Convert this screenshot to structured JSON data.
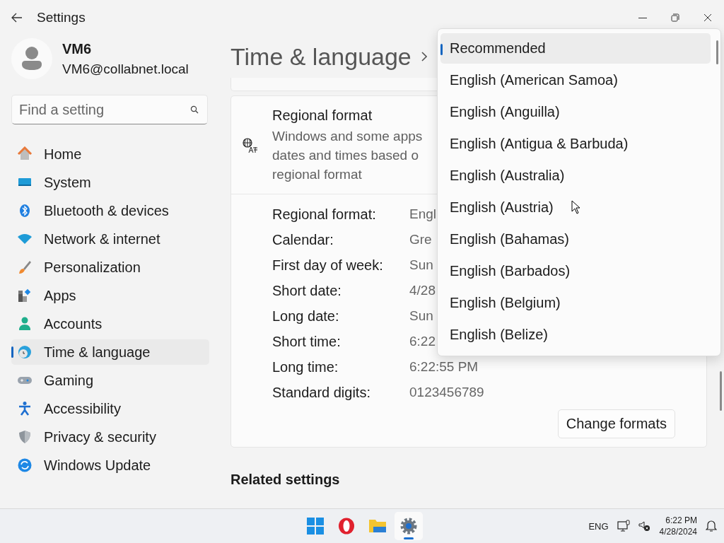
{
  "window": {
    "title": "Settings"
  },
  "user": {
    "name": "VM6",
    "email": "VM6@collabnet.local"
  },
  "search": {
    "placeholder": "Find a setting"
  },
  "nav": [
    {
      "label": "Home",
      "kind": "home",
      "selected": false
    },
    {
      "label": "System",
      "kind": "system",
      "selected": false
    },
    {
      "label": "Bluetooth & devices",
      "kind": "bluetooth",
      "selected": false
    },
    {
      "label": "Network & internet",
      "kind": "network",
      "selected": false
    },
    {
      "label": "Personalization",
      "kind": "brush",
      "selected": false
    },
    {
      "label": "Apps",
      "kind": "apps",
      "selected": false
    },
    {
      "label": "Accounts",
      "kind": "person",
      "selected": false
    },
    {
      "label": "Time & language",
      "kind": "clock",
      "selected": true
    },
    {
      "label": "Gaming",
      "kind": "gamepad",
      "selected": false
    },
    {
      "label": "Accessibility",
      "kind": "accessibility",
      "selected": false
    },
    {
      "label": "Privacy & security",
      "kind": "shield",
      "selected": false
    },
    {
      "label": "Windows Update",
      "kind": "update",
      "selected": false
    }
  ],
  "page": {
    "title": "Time & language"
  },
  "regional_card": {
    "title": "Regional format",
    "description": [
      "Windows and some apps",
      "dates and times based o",
      "regional format"
    ]
  },
  "formats": [
    {
      "label": "Regional format:",
      "value": "Engl"
    },
    {
      "label": "Calendar:",
      "value": "Gre"
    },
    {
      "label": "First day of week:",
      "value": "Sun"
    },
    {
      "label": "Short date:",
      "value": "4/28"
    },
    {
      "label": "Long date:",
      "value": "Sun"
    },
    {
      "label": "Short time:",
      "value": "6:22"
    },
    {
      "label": "Long time:",
      "value": "6:22:55 PM"
    },
    {
      "label": "Standard digits:",
      "value": "0123456789"
    }
  ],
  "change_button": "Change formats",
  "related_heading": "Related settings",
  "dropdown": {
    "items": [
      {
        "label": "Recommended",
        "selected": true
      },
      {
        "label": "English (American Samoa)",
        "selected": false
      },
      {
        "label": "English (Anguilla)",
        "selected": false
      },
      {
        "label": "English (Antigua & Barbuda)",
        "selected": false
      },
      {
        "label": "English (Australia)",
        "selected": false
      },
      {
        "label": "English (Austria)",
        "selected": false
      },
      {
        "label": "English (Bahamas)",
        "selected": false
      },
      {
        "label": "English (Barbados)",
        "selected": false
      },
      {
        "label": "English (Belgium)",
        "selected": false
      },
      {
        "label": "English (Belize)",
        "selected": false
      }
    ]
  },
  "taskbar": {
    "apps": [
      {
        "kind": "start",
        "active": false
      },
      {
        "kind": "opera",
        "active": false
      },
      {
        "kind": "folder",
        "active": false
      },
      {
        "kind": "settings",
        "active": true
      }
    ],
    "language": "ENG",
    "time": "6:22 PM",
    "date": "4/28/2024"
  }
}
